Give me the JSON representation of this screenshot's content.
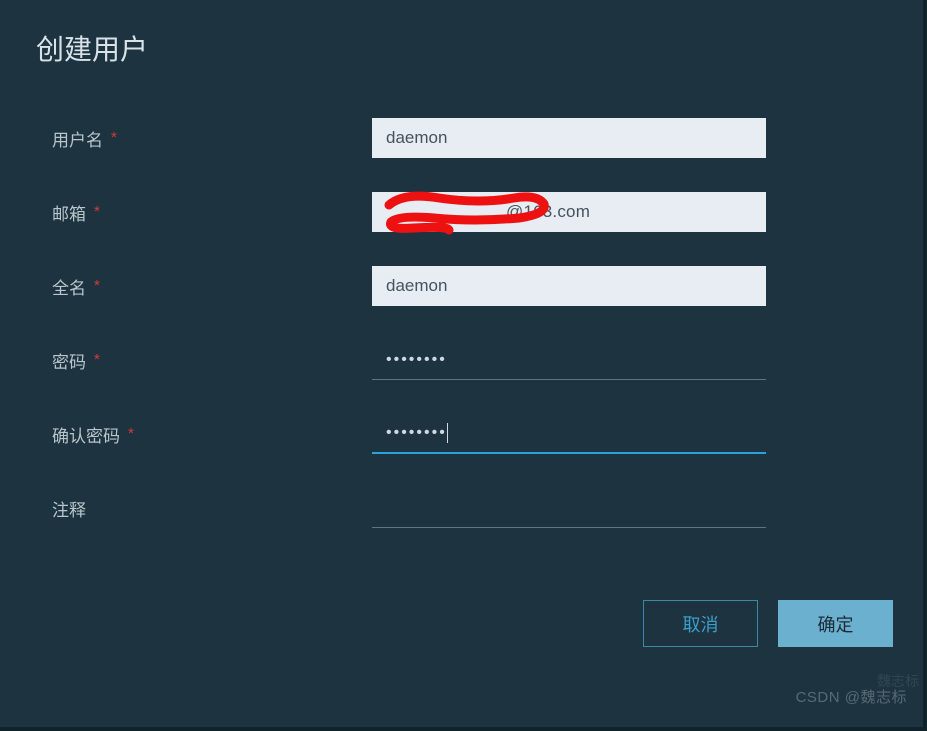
{
  "title": "创建用户",
  "fields": {
    "username": {
      "label": "用户名",
      "required": true,
      "value": "daemon"
    },
    "email": {
      "label": "邮箱",
      "required": true,
      "visible_suffix": "@163.com"
    },
    "fullname": {
      "label": "全名",
      "required": true,
      "value": "daemon"
    },
    "password": {
      "label": "密码",
      "required": true,
      "mask": "••••••••"
    },
    "confirm": {
      "label": "确认密码",
      "required": true,
      "mask": "••••••••"
    },
    "comment": {
      "label": "注释",
      "required": false,
      "value": ""
    }
  },
  "required_marker": "*",
  "buttons": {
    "cancel": "取消",
    "confirm": "确定"
  },
  "watermark": "CSDN @魏志标",
  "watermark2": "魏志标",
  "colors": {
    "background": "#1d3440",
    "accent": "#2aa3dc",
    "input_bg": "#e7edf2",
    "required": "#d93838",
    "btn_primary": "#6cb0d0"
  }
}
